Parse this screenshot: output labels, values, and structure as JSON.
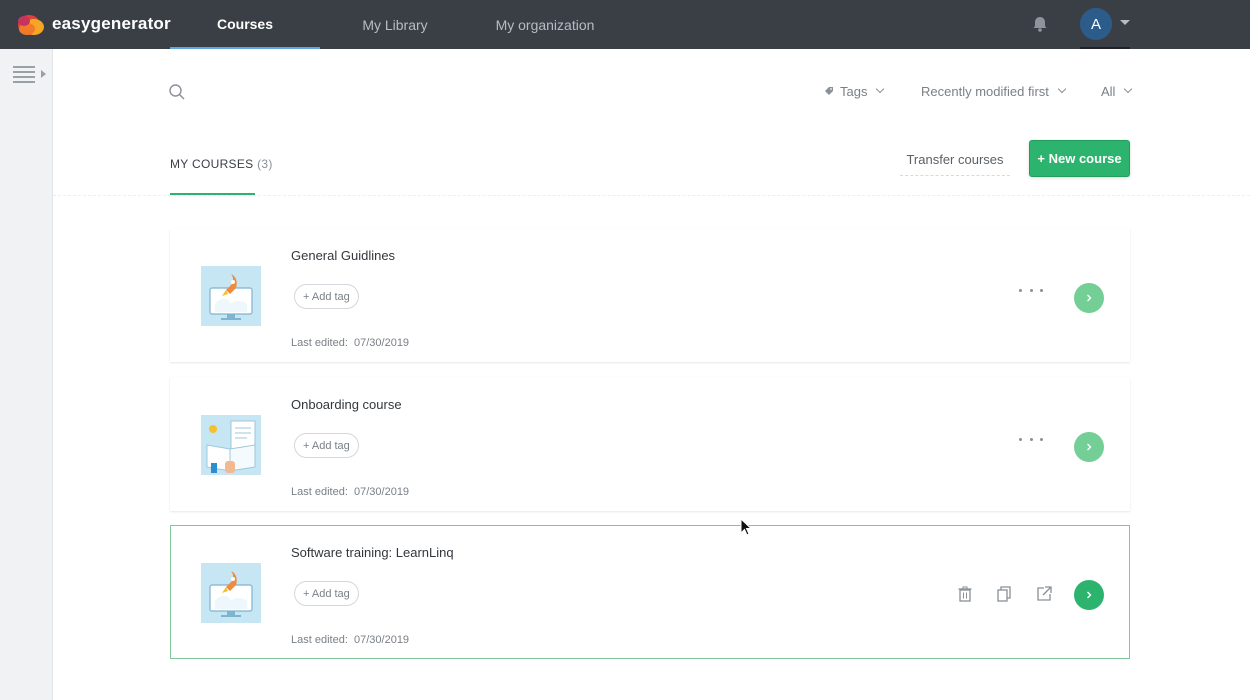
{
  "app": {
    "logo_text": "easygenerator",
    "nav_tabs": [
      {
        "label": "Courses",
        "active": true
      },
      {
        "label": "My Library",
        "active": false
      },
      {
        "label": "My organization",
        "active": false
      }
    ],
    "avatar_initial": "A"
  },
  "toolbar": {
    "tags_label": "Tags",
    "sort_label": "Recently modified first",
    "filter_label": "All"
  },
  "section": {
    "title": "MY COURSES",
    "count": "(3)",
    "transfer_label": "Transfer courses",
    "new_course_label": "+ New course"
  },
  "courses": [
    {
      "title": "General Guidlines",
      "add_tag_label": "+ Add tag",
      "last_edited_label": "Last edited:",
      "last_edited_date": "07/30/2019",
      "thumbnail": "rocket-computer"
    },
    {
      "title": "Onboarding course",
      "add_tag_label": "+ Add tag",
      "last_edited_label": "Last edited:",
      "last_edited_date": "07/30/2019",
      "thumbnail": "book-documents"
    },
    {
      "title": "Software training: LearnLinq",
      "add_tag_label": "+ Add tag",
      "last_edited_label": "Last edited:",
      "last_edited_date": "07/30/2019",
      "thumbnail": "rocket-computer"
    }
  ],
  "colors": {
    "topbar": "#3a3f46",
    "accent_green": "#2cb46e",
    "go_button": "#73cf95",
    "active_tab_underline": "#5aa7e6"
  },
  "icons": [
    "logo-icon",
    "bell-icon",
    "hamburger-icon",
    "search-icon",
    "tag-icon",
    "chevron-down-icon",
    "more-options-icon",
    "arrow-right-icon",
    "trash-icon",
    "copy-icon",
    "share-icon"
  ]
}
